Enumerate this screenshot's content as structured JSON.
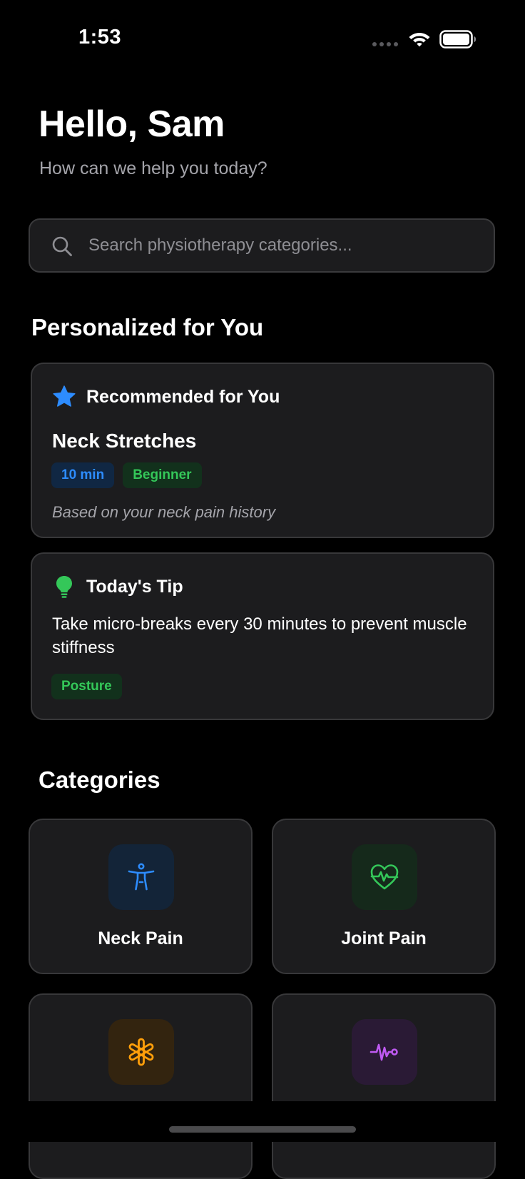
{
  "status_bar": {
    "time": "1:53",
    "wifi_icon": "wifi-icon",
    "battery_icon": "battery-icon"
  },
  "header": {
    "greeting": "Hello, Sam",
    "subtitle": "How can we help you today?"
  },
  "search": {
    "placeholder": "Search physiotherapy categories...",
    "value": "",
    "icon": "search-icon"
  },
  "personalized": {
    "title": "Personalized for You",
    "recommended": {
      "icon": "star-icon",
      "header": "Recommended for You",
      "title": "Neck Stretches",
      "duration": "10 min",
      "level": "Beginner",
      "note": "Based on your neck pain history"
    },
    "tip": {
      "icon": "lightbulb-icon",
      "header": "Today's Tip",
      "text": "Take micro-breaks every 30 minutes to prevent muscle stiffness",
      "tag": "Posture"
    }
  },
  "categories": {
    "title": "Categories",
    "items": [
      {
        "label": "Neck Pain",
        "icon": "figure-stretch-icon",
        "color": "#2d8cff"
      },
      {
        "label": "Joint Pain",
        "icon": "heart-pulse-icon",
        "color": "#34c759"
      },
      {
        "label": "",
        "icon": "asterisk-icon",
        "color": "#ff9f0a"
      },
      {
        "label": "",
        "icon": "waveform-icon",
        "color": "#bf5af2"
      }
    ]
  },
  "colors": {
    "background": "#000000",
    "card": "#1c1c1e",
    "accent_blue": "#2d8cff",
    "accent_green": "#34c759",
    "accent_orange": "#ff9f0a",
    "accent_purple": "#bf5af2"
  }
}
